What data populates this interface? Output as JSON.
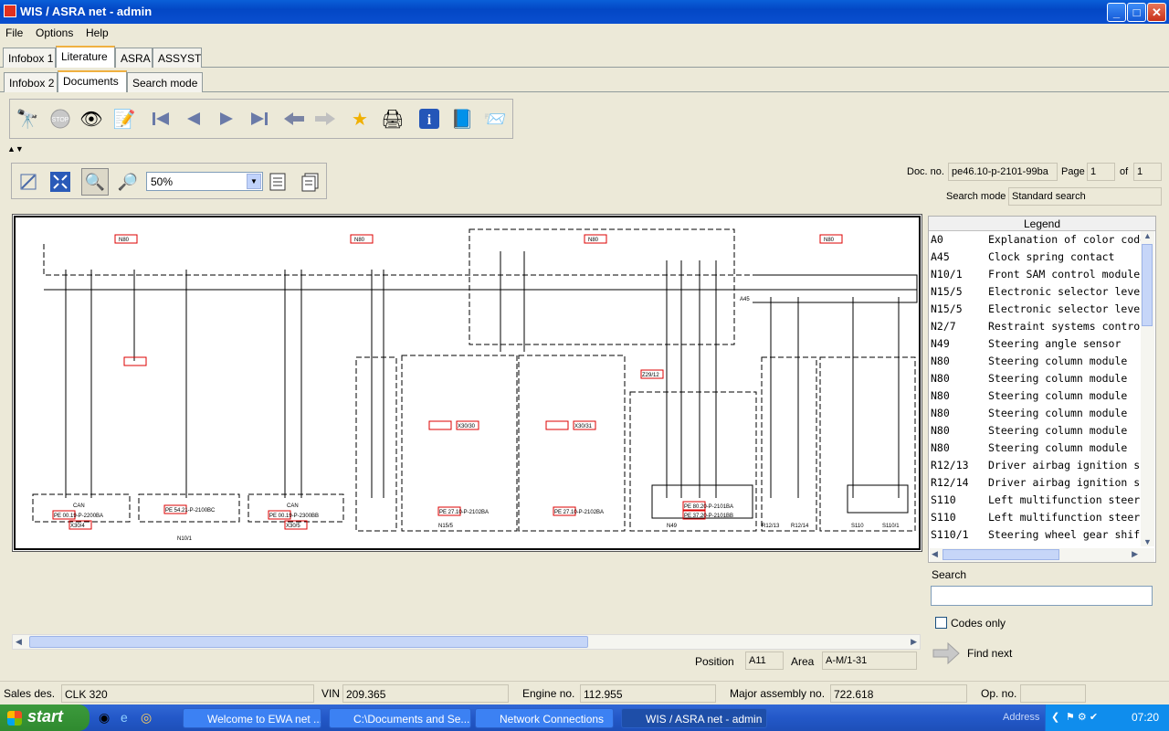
{
  "window": {
    "title": "WIS / ASRA net - admin",
    "minimize": "_",
    "maximize": "□",
    "close": "✕"
  },
  "menu": [
    "File",
    "Options",
    "Help"
  ],
  "main_tabs": [
    "Infobox 1",
    "Literature",
    "ASRA",
    "ASSYST"
  ],
  "sub_tabs": [
    "Infobox 2",
    "Documents",
    "Search mode"
  ],
  "toolbar_icons": [
    "binoculars-icon",
    "stop-icon",
    "eye-icon",
    "edit-icon",
    "first-page-icon",
    "previous-icon",
    "next-icon",
    "last-page-icon",
    "back-icon",
    "forward-icon",
    "star-icon",
    "print-icon",
    "info-icon",
    "book-icon",
    "mail-icon"
  ],
  "zoom": {
    "value": "50%"
  },
  "document": {
    "doc_no_label": "Doc. no.",
    "doc_no": "pe46.10-p-2101-99ba",
    "page_label": "Page",
    "page": "1",
    "of_label": "of",
    "page_total": "1",
    "search_mode_label": "Search mode",
    "search_mode": "Standard search"
  },
  "legend": {
    "title": "Legend",
    "items": [
      {
        "code": "A0",
        "desc": "Explanation of color code"
      },
      {
        "code": "A45",
        "desc": "Clock spring contact"
      },
      {
        "code": "N10/1",
        "desc": "Front SAM control module"
      },
      {
        "code": "N15/5",
        "desc": "Electronic selector lever"
      },
      {
        "code": "N15/5",
        "desc": "Electronic selector lever"
      },
      {
        "code": "N2/7",
        "desc": "Restraint systems control"
      },
      {
        "code": "N49",
        "desc": "Steering angle sensor"
      },
      {
        "code": "N80",
        "desc": "Steering column module"
      },
      {
        "code": "N80",
        "desc": "Steering column module"
      },
      {
        "code": "N80",
        "desc": "Steering column module"
      },
      {
        "code": "N80",
        "desc": "Steering column module"
      },
      {
        "code": "N80",
        "desc": "Steering column module"
      },
      {
        "code": "N80",
        "desc": "Steering column module"
      },
      {
        "code": "R12/13",
        "desc": "Driver airbag ignition s"
      },
      {
        "code": "R12/14",
        "desc": "Driver airbag ignition s"
      },
      {
        "code": "S110",
        "desc": "Left multifunction steer"
      },
      {
        "code": "S110",
        "desc": "Left multifunction steer"
      },
      {
        "code": "S110/1",
        "desc": "Steering wheel gear shif"
      }
    ]
  },
  "search": {
    "label": "Search",
    "value": "",
    "codes_only": "Codes only",
    "find_next": "Find next"
  },
  "position": {
    "label": "Position",
    "value": "A11",
    "area_label": "Area",
    "area_value": "A-M/1-31"
  },
  "diagram": {
    "labels": [
      "N80",
      "N80",
      "N80",
      "N80",
      "A45",
      "N10/1",
      "N15/5",
      "N49",
      "R12/13",
      "R12/14",
      "S110",
      "S110/1",
      "CAN"
    ],
    "refs": [
      "PE 00.19-P-2200BA",
      "PE 54.21-P-2100BC",
      "PE 00.19-P-2300BB",
      "PE 27.10-P-2102BA",
      "PE 27.10-P-2102BA",
      "PE 80.20-P-2101BA",
      "PE 37.20-P-2101BB",
      "X30/4",
      "X30/5",
      "X30/30",
      "X30/31",
      "Z29/12"
    ]
  },
  "status": {
    "sales_label": "Sales des.",
    "sales": "CLK 320",
    "vin_label": "VIN",
    "vin": "209.365",
    "engine_label": "Engine no.",
    "engine": "112.955",
    "major_label": "Major assembly no.",
    "major": "722.618",
    "op_label": "Op. no.",
    "op": ""
  },
  "taskbar": {
    "start": "start",
    "tasks": [
      "Welcome to EWA net ...",
      "C:\\Documents and Se...",
      "Network Connections",
      "WIS / ASRA net - admin"
    ],
    "address": "Address",
    "clock": "07:20"
  }
}
